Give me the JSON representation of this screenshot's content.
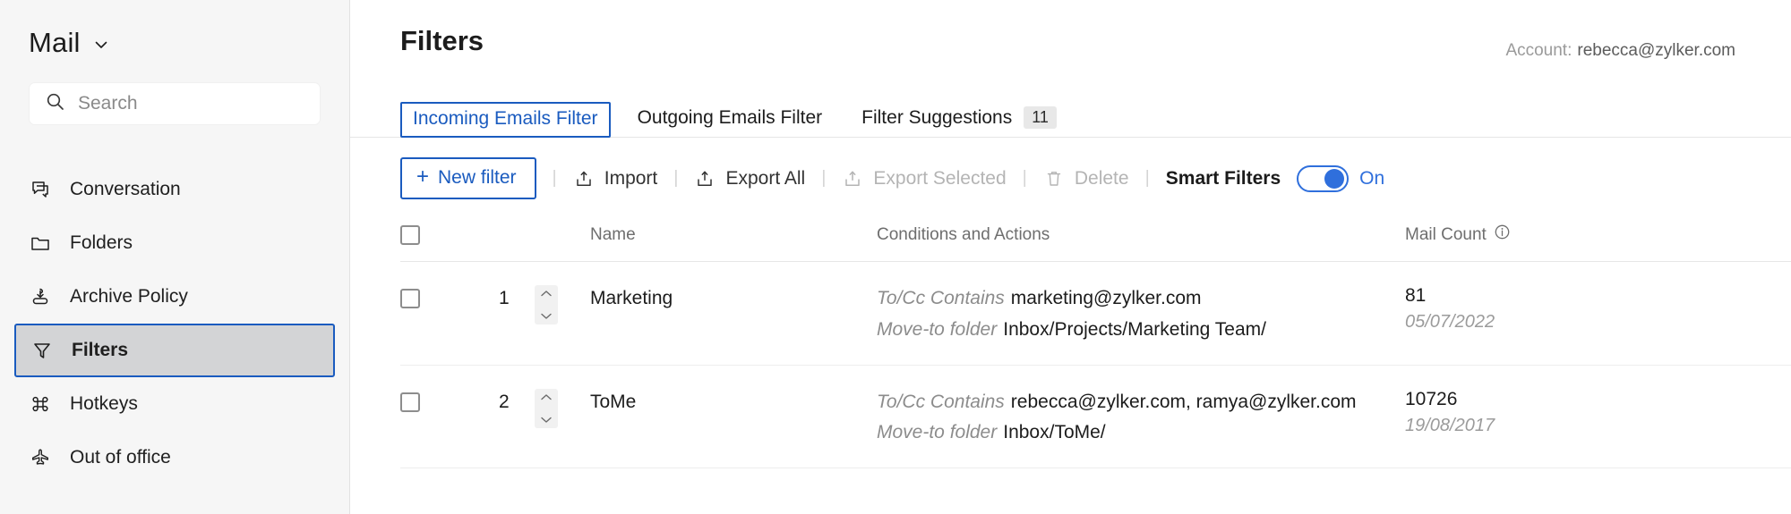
{
  "sidebar": {
    "brand": "Mail",
    "brand_icon": "chevron-down-icon",
    "search": {
      "placeholder": "Search",
      "icon": "search-icon"
    },
    "items": [
      {
        "label": "Conversation",
        "icon": "conversation-icon",
        "active": false
      },
      {
        "label": "Folders",
        "icon": "folder-icon",
        "active": false
      },
      {
        "label": "Archive Policy",
        "icon": "archive-icon",
        "active": false
      },
      {
        "label": "Filters",
        "icon": "filter-funnel-icon",
        "active": true
      },
      {
        "label": "Hotkeys",
        "icon": "command-key-icon",
        "active": false
      },
      {
        "label": "Out of office",
        "icon": "airplane-icon",
        "active": false
      }
    ]
  },
  "header": {
    "title": "Filters",
    "account_label": "Account:",
    "account_value": "rebecca@zylker.com"
  },
  "tabs": [
    {
      "label": "Incoming Emails Filter",
      "badge": "",
      "active": true
    },
    {
      "label": "Outgoing Emails Filter",
      "badge": "",
      "active": false
    },
    {
      "label": "Filter Suggestions",
      "badge": "11",
      "active": false
    }
  ],
  "toolbar": {
    "new_filter": "New filter",
    "new_filter_icon": "plus-icon",
    "import": "Import",
    "import_icon": "import-icon",
    "export_all": "Export All",
    "export_all_icon": "export-icon",
    "export_selected": "Export Selected",
    "export_selected_icon": "export-icon",
    "delete": "Delete",
    "delete_icon": "trash-icon",
    "smart_filters_label": "Smart Filters",
    "smart_filters_state": "On",
    "separator": "|"
  },
  "table": {
    "columns": {
      "name": "Name",
      "conditions": "Conditions and Actions",
      "mail_count": "Mail Count",
      "mail_count_icon": "info-icon"
    },
    "rows": [
      {
        "index": "1",
        "name": "Marketing",
        "condition_key": "To/Cc Contains",
        "condition_value": "marketing@zylker.com",
        "action_key": "Move-to folder",
        "action_value": "Inbox/Projects/Marketing Team/",
        "count": "81",
        "date": "05/07/2022"
      },
      {
        "index": "2",
        "name": "ToMe",
        "condition_key": "To/Cc Contains",
        "condition_value": "rebecca@zylker.com, ramya@zylker.com",
        "action_key": "Move-to folder",
        "action_value": "Inbox/ToMe/",
        "count": "10726",
        "date": "19/08/2017"
      }
    ]
  },
  "colors": {
    "accent": "#1a5bbf",
    "toggle_on": "#2f6fdc",
    "sidebar_bg": "#f6f6f6",
    "active_row_bg": "#d3d4d6"
  }
}
